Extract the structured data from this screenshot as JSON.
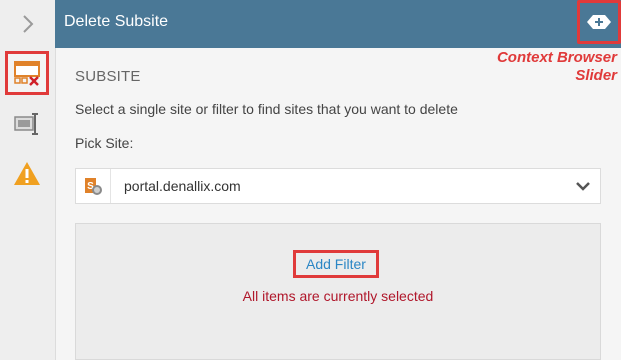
{
  "header": {
    "title": "Delete Subsite"
  },
  "context_slider": {
    "label_line1": "Context Browser",
    "label_line2": "Slider",
    "icon": "arrows-horizontal-icon"
  },
  "rail": {
    "items": [
      {
        "icon": "chevron-right-icon"
      },
      {
        "icon": "delete-subsite-icon"
      },
      {
        "icon": "text-box-icon"
      },
      {
        "icon": "warning-icon"
      }
    ]
  },
  "content": {
    "section_title": "SUBSITE",
    "description": "Select a single site or filter to find sites that you want to delete",
    "pick_label": "Pick Site:",
    "site_value": "portal.denallix.com",
    "add_filter_label": "Add Filter",
    "selected_text": "All items are currently selected"
  },
  "colors": {
    "header_bg": "#4a7896",
    "highlight": "#e03a3a",
    "link": "#2b86c5",
    "error_text": "#b0172b"
  }
}
